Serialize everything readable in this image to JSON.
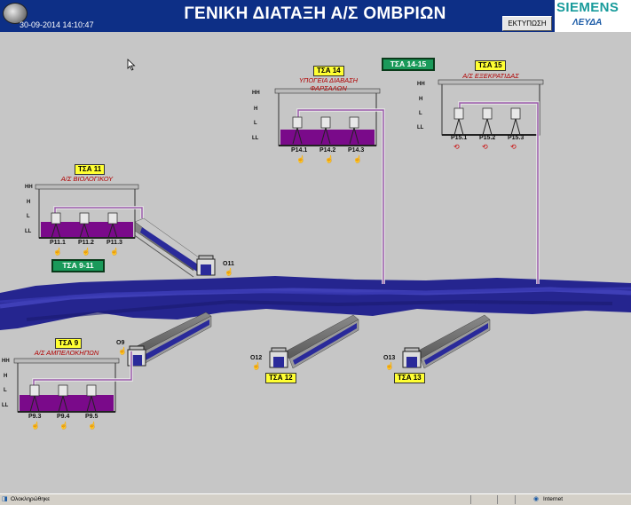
{
  "header": {
    "title": "ΓΕΝΙΚΗ ΔΙΑΤΑΞΗ Α/Σ ΟΜΒΡΙΩΝ",
    "datetime": "30-09-2014 14:10:47",
    "print_label": "ΕΚΤΥΠΩΣΗ",
    "brand_top": "SIEMENS",
    "brand_bottom": "ΛΕΥΔΑ"
  },
  "levels": [
    "HH",
    "H",
    "L",
    "LL"
  ],
  "stations": {
    "s14": {
      "tag": "ΤΣΑ 14",
      "title": "ΥΠΟΓΕΙΑ ΔΙΑΒΑΣΗ ΦΑΡΣΑΛΩΝ",
      "pumps": [
        "P14.1",
        "P14.2",
        "P14.3"
      ]
    },
    "s15": {
      "tag": "ΤΣΑ 15",
      "title": "Α/Σ ΕΞΕΚΡΑΤΙΔΑΣ",
      "pumps": [
        "P15.1",
        "P15.2",
        "P15.3"
      ]
    },
    "s11": {
      "tag": "ΤΣΑ 11",
      "title": "Α/Σ ΒΙΟΛΟΓΙΚΟΥ",
      "pumps": [
        "P11.1",
        "P11.2",
        "P11.3"
      ],
      "outlet": "O11"
    },
    "s9": {
      "tag": "ΤΣΑ 9",
      "title": "Α/Σ ΑΜΠΕΛΟΚΗΠΩΝ",
      "pumps": [
        "P9.3",
        "P9.4",
        "P9.5"
      ],
      "outlet": "O9"
    },
    "s12": {
      "tag": "ΤΣΑ 12",
      "outlet": "O12"
    },
    "s13": {
      "tag": "ΤΣΑ 13",
      "outlet": "O13"
    }
  },
  "buttons": {
    "b1415": "ΤΣΑ 14-15",
    "b911": "ΤΣΑ 9-11"
  },
  "statusbar": {
    "left": "Ολοκληρώθηκε",
    "right": "Internet"
  },
  "colors": {
    "header": "#0d2f86",
    "water": "#20209a",
    "tank_liquid": "#7a0a8a",
    "tag": "#ffff33",
    "button": "#1a9a5a",
    "pipe": "#9a5aaa"
  }
}
